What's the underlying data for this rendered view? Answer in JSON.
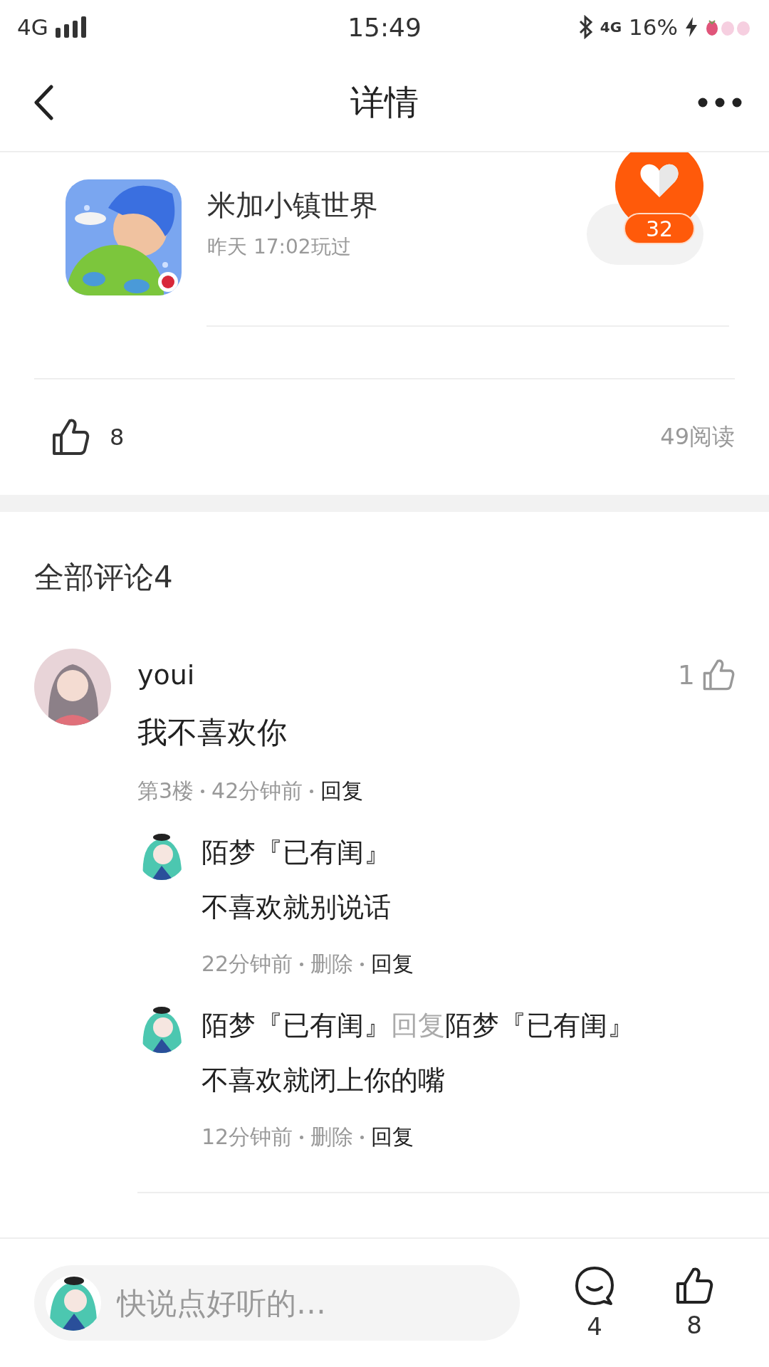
{
  "status_bar": {
    "network": "4G",
    "time": "15:49",
    "data_network": "4G",
    "battery": "16%"
  },
  "nav": {
    "title": "详情"
  },
  "game": {
    "name": "米加小镇世界",
    "played": "昨天 17:02玩过"
  },
  "floating_like": {
    "count": "32"
  },
  "stats": {
    "likes": "8",
    "reads": "49阅读"
  },
  "comments_header": "全部评论4",
  "comments": [
    {
      "user": "youi",
      "likes": "1",
      "text": "我不喜欢你",
      "meta": [
        {
          "kind": "info",
          "text": "第3楼"
        },
        {
          "kind": "info",
          "text": "42分钟前"
        },
        {
          "kind": "action",
          "text": "回复"
        }
      ],
      "replies": [
        {
          "user": "陌梦『已有闺』",
          "text": "不喜欢就别说话",
          "meta": [
            {
              "kind": "info",
              "text": "22分钟前"
            },
            {
              "kind": "info",
              "text": "删除"
            },
            {
              "kind": "action",
              "text": "回复"
            }
          ]
        },
        {
          "user": "陌梦『已有闺』",
          "reply_label": "回复",
          "reply_to": "陌梦『已有闺』",
          "text": "不喜欢就闭上你的嘴",
          "meta": [
            {
              "kind": "info",
              "text": "12分钟前"
            },
            {
              "kind": "info",
              "text": "删除"
            },
            {
              "kind": "action",
              "text": "回复"
            }
          ]
        }
      ]
    }
  ],
  "bottom_bar": {
    "placeholder": "快说点好听的…",
    "comments": "4",
    "likes": "8"
  }
}
